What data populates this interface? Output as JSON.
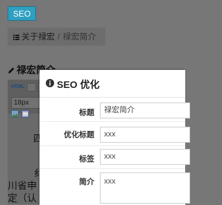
{
  "seo_button": "SEO",
  "breadcrumb": {
    "parent": "关于禄宏",
    "separator": "/",
    "current": "禄宏简介"
  },
  "section_title": "禄宏简介",
  "editor": {
    "html_button": "HTML",
    "font_size": "18px",
    "body_fragments": [
      "四",
      "纟",
      "川省申",
      "定（认"
    ]
  },
  "modal": {
    "title": "SEO 优化",
    "fields": [
      {
        "label": "标题",
        "value": "禄宏简介"
      },
      {
        "label": "优化标题",
        "value": "xxx"
      },
      {
        "label": "标签",
        "value": "xxx"
      },
      {
        "label": "简介",
        "value": "xxx"
      }
    ]
  }
}
